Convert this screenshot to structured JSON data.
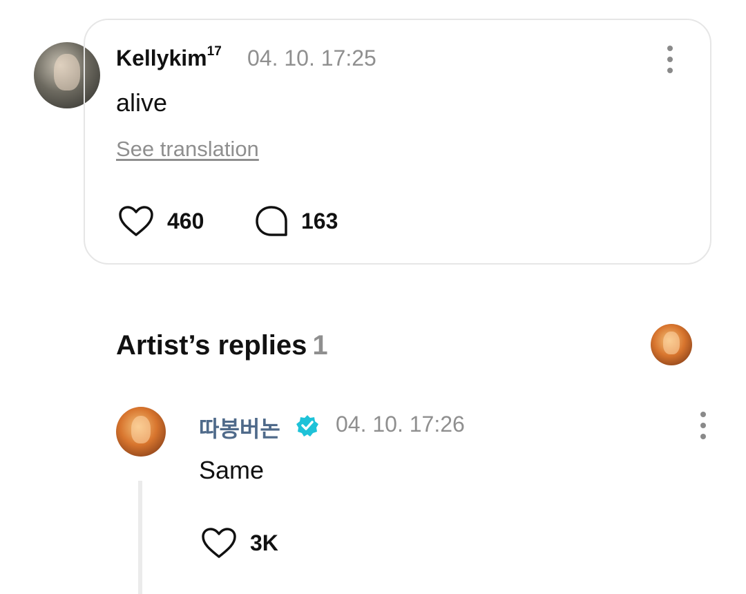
{
  "comment": {
    "author": "Kellykim",
    "author_suffix": "17",
    "timestamp": "04. 10. 17:25",
    "text": "alive",
    "translate_label": "See translation",
    "likes": "460",
    "replies": "163"
  },
  "artist_replies": {
    "title": "Artist’s replies",
    "count": "1"
  },
  "reply": {
    "author": "따봉버논",
    "timestamp": "04. 10. 17:26",
    "text": "Same",
    "likes": "3K"
  },
  "colors": {
    "verified_badge": "#1ec2d8",
    "artist_name": "#4f6a8a",
    "muted_text": "#8f8f8f",
    "card_border": "#e6e6e6"
  },
  "icons": [
    "avatar",
    "kebab-menu-icon",
    "heart-icon",
    "comment-bubble-icon",
    "verified-badge-icon"
  ]
}
